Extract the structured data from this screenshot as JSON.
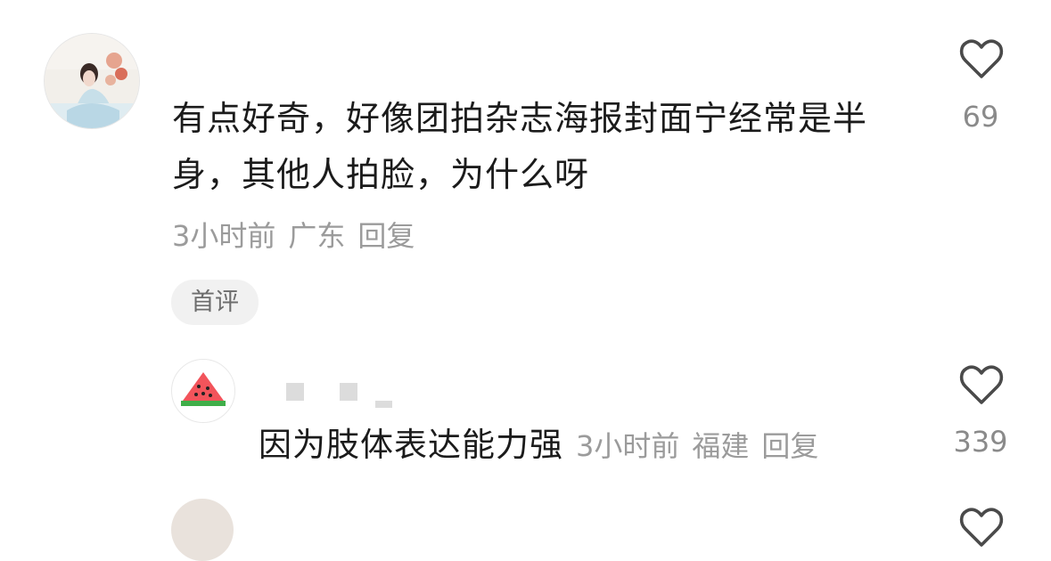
{
  "comment": {
    "text": "有点好奇，好像团拍杂志海报封面宁经常是半身，其他人拍脸，为什么呀",
    "time": "3小时前",
    "location": "广东",
    "reply_label": "回复",
    "badge": "首评",
    "like_count": "69"
  },
  "reply": {
    "text": "因为肢体表达能力强",
    "time": "3小时前",
    "location": "福建",
    "reply_label": "回复",
    "like_count": "339"
  },
  "icons": {
    "like": "heart-outline-icon",
    "reply_avatar": "watermelon-icon"
  },
  "colors": {
    "text": "#1b1b1b",
    "meta": "#9b9b9b",
    "badge_bg": "#f1f1f1",
    "watermelon_red": "#f2545b",
    "watermelon_green": "#3fae49"
  }
}
